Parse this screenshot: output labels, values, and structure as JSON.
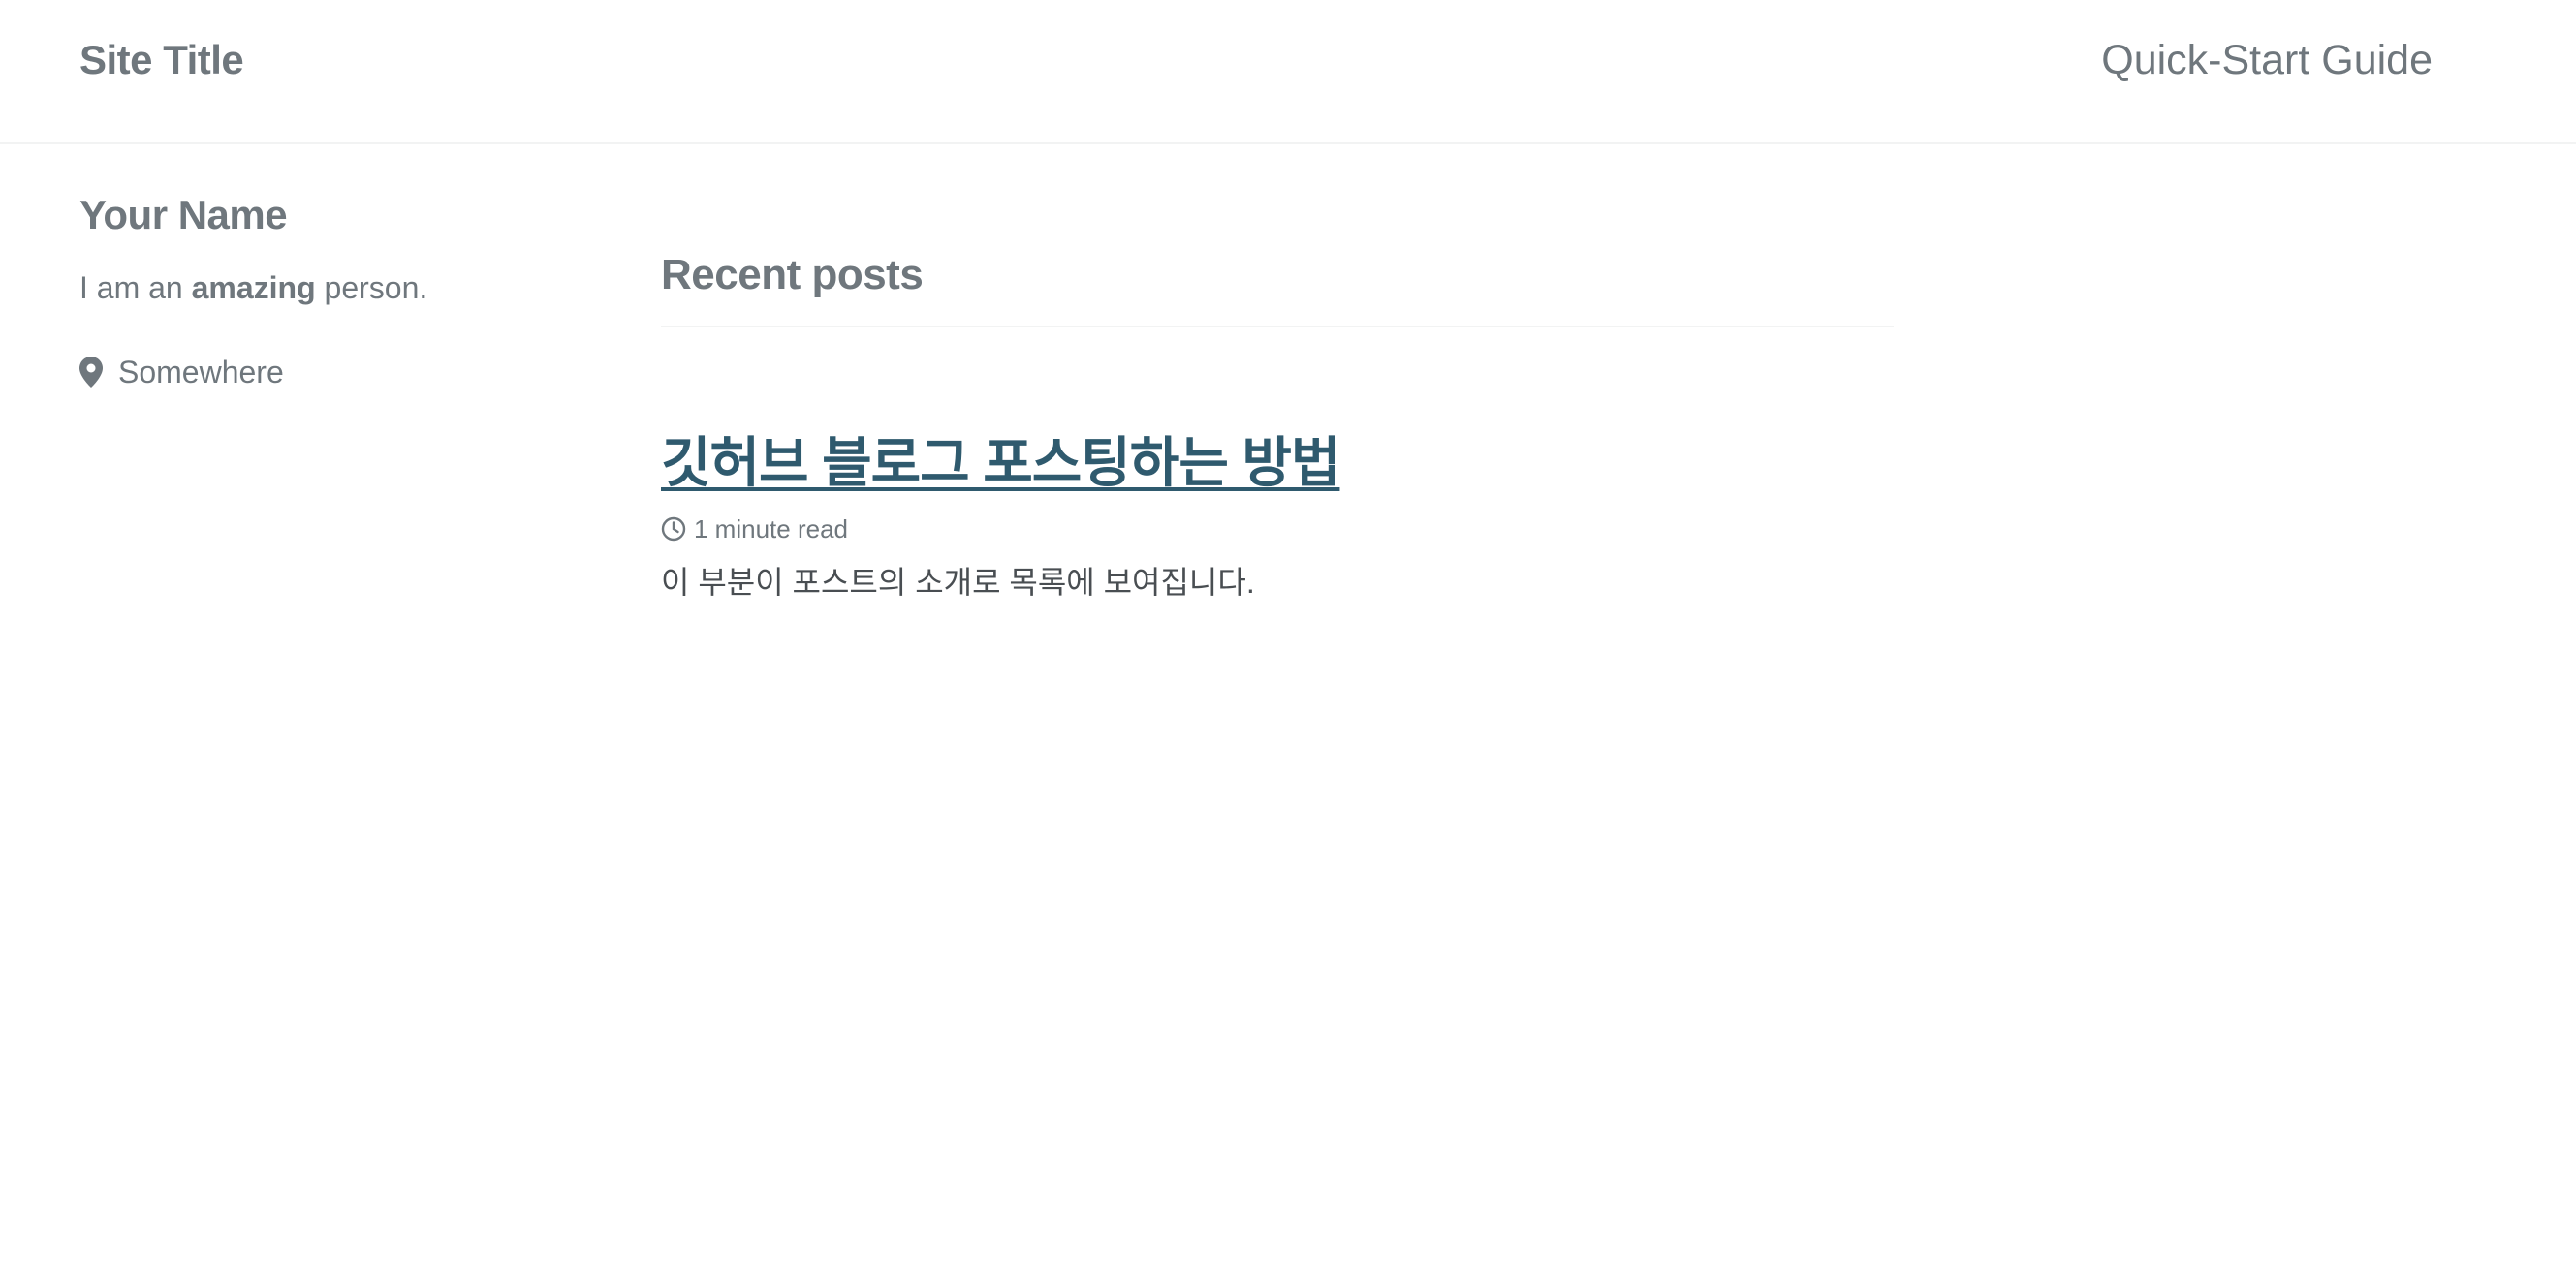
{
  "masthead": {
    "site_title": "Site Title",
    "nav_items": [
      {
        "label": "Quick-Start Guide"
      }
    ]
  },
  "author": {
    "name": "Your Name",
    "bio_before": "I am an ",
    "bio_bold": "amazing",
    "bio_after": " person.",
    "location": "Somewhere",
    "location_icon": "map-marker-icon"
  },
  "main": {
    "section_title": "Recent posts",
    "posts": [
      {
        "title": "깃허브 블로그 포스팅하는 방법",
        "read_time": "1 minute read",
        "read_time_icon": "clock-icon",
        "excerpt": "이 부분이 포스트의 소개로 목록에 보여집니다."
      }
    ]
  },
  "colors": {
    "text_muted": "#6f777d",
    "link": "#2f5a6e",
    "body_text": "#494e52",
    "border": "#f2f3f3"
  }
}
